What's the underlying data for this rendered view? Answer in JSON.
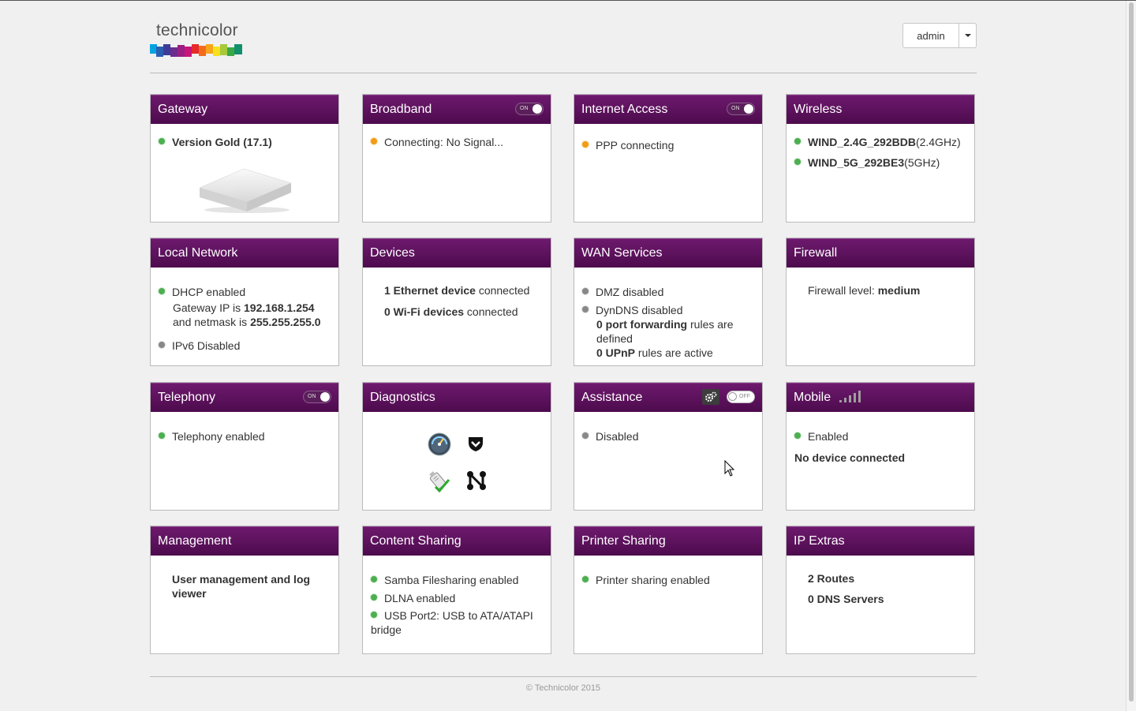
{
  "header": {
    "logo_text": "technicolor",
    "user_label": "admin"
  },
  "cards": {
    "gateway": {
      "title": "Gateway",
      "version": "Version Gold (17.1)"
    },
    "broadband": {
      "title": "Broadband",
      "toggle": "ON",
      "status": "Connecting: No Signal..."
    },
    "internet": {
      "title": "Internet Access",
      "toggle": "ON",
      "status": "PPP connecting"
    },
    "wireless": {
      "title": "Wireless",
      "networks": [
        {
          "ssid": "WIND_2.4G_292BDB",
          "band": "(2.4GHz)"
        },
        {
          "ssid": "WIND_5G_292BE3",
          "band": "(5GHz)"
        }
      ]
    },
    "local_network": {
      "title": "Local Network",
      "dhcp": "DHCP enabled",
      "gw_ip_prefix": "Gateway IP is ",
      "gw_ip": "192.168.1.254",
      "netmask_prefix": "and netmask is ",
      "netmask": "255.255.255.0",
      "ipv6": "IPv6 Disabled"
    },
    "devices": {
      "title": "Devices",
      "eth_count": "1 Ethernet device",
      "eth_suffix": " connected",
      "wifi_count": "0 Wi-Fi devices",
      "wifi_suffix": " connected"
    },
    "wan": {
      "title": "WAN Services",
      "dmz": "DMZ disabled",
      "dyndns": "DynDNS disabled",
      "pf_bold": "0 port forwarding",
      "pf_rest": " rules are defined",
      "upnp_bold": "0 UPnP",
      "upnp_rest": " rules are active"
    },
    "firewall": {
      "title": "Firewall",
      "label": "Firewall level: ",
      "level": "medium"
    },
    "telephony": {
      "title": "Telephony",
      "toggle": "ON",
      "status": "Telephony enabled"
    },
    "diagnostics": {
      "title": "Diagnostics"
    },
    "assistance": {
      "title": "Assistance",
      "toggle": "OFF",
      "status": "Disabled"
    },
    "mobile": {
      "title": "Mobile",
      "status": "Enabled",
      "device": "No device connected"
    },
    "management": {
      "title": "Management",
      "text": "User management and log viewer"
    },
    "content_sharing": {
      "title": "Content Sharing",
      "items": [
        "Samba Filesharing enabled",
        "DLNA enabled",
        "USB Port2: USB to ATA/ATAPI bridge"
      ]
    },
    "printer_sharing": {
      "title": "Printer Sharing",
      "status": "Printer sharing enabled"
    },
    "ip_extras": {
      "title": "IP Extras",
      "routes": "2 Routes",
      "dns": "0 DNS Servers"
    }
  },
  "footer": {
    "copyright": "© Technicolor 2015"
  },
  "colors": {
    "header_purple": "#5c115c",
    "status_green": "#4caf50",
    "status_orange": "#f39c12",
    "status_grey": "#888888"
  }
}
